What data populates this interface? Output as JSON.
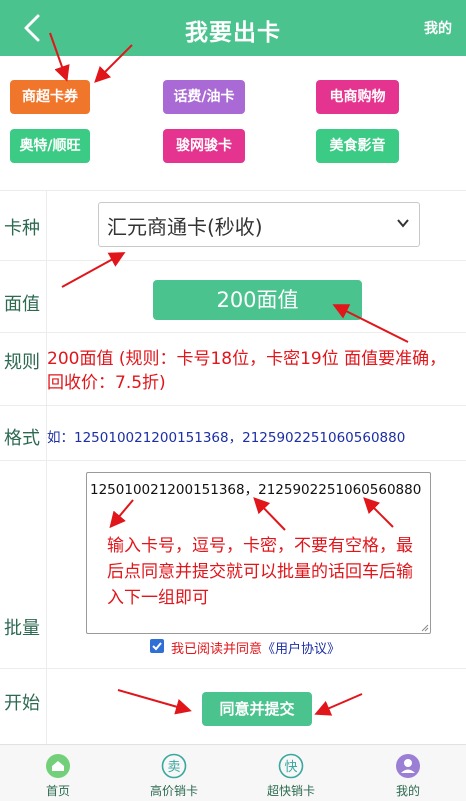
{
  "header": {
    "title": "我要出卡",
    "right_label": "我的"
  },
  "categories": [
    {
      "label": "商超卡券",
      "color": "#f0762b"
    },
    {
      "label": "话费/油卡",
      "color": "#a96ad6"
    },
    {
      "label": "电商购物",
      "color": "#e5348f"
    },
    {
      "label": "奥特/顺旺",
      "color": "#3ccb85"
    },
    {
      "label": "骏网骏卡",
      "color": "#e5348f"
    },
    {
      "label": "美食影音",
      "color": "#3ccb85"
    }
  ],
  "form": {
    "card_type_label": "卡种",
    "card_type_value": "汇元商通卡(秒收)",
    "face_label": "面值",
    "face_value": "200面值",
    "rule_label": "规则",
    "rule_text": "200面值   (规则：卡号18位，卡密19位 面值要准确，回收价：7.5折)",
    "format_label": "格式",
    "format_text": "如：125010021200151368，2125902251060560880",
    "batch_label": "批量",
    "batch_value": "125010021200151368，2125902251060560880",
    "batch_note": "输入卡号，逗号，卡密，不要有空格，最后点同意并提交就可以批量的话回车后输入下一组即可",
    "agree_text": "我已阅读并同意",
    "agree_link": "《用户协议》",
    "start_label": "开始",
    "submit_label": "同意并提交"
  },
  "tabbar": [
    {
      "label": "首页",
      "icon": "home-icon"
    },
    {
      "label": "高价销卡",
      "icon": "sell-icon"
    },
    {
      "label": "超快销卡",
      "icon": "fast-icon"
    },
    {
      "label": "我的",
      "icon": "profile-icon"
    }
  ],
  "tab_icons": {
    "sell": "卖",
    "fast": "快"
  },
  "colors": {
    "brand": "#4bc38e",
    "annotation_red": "#e0161b"
  }
}
